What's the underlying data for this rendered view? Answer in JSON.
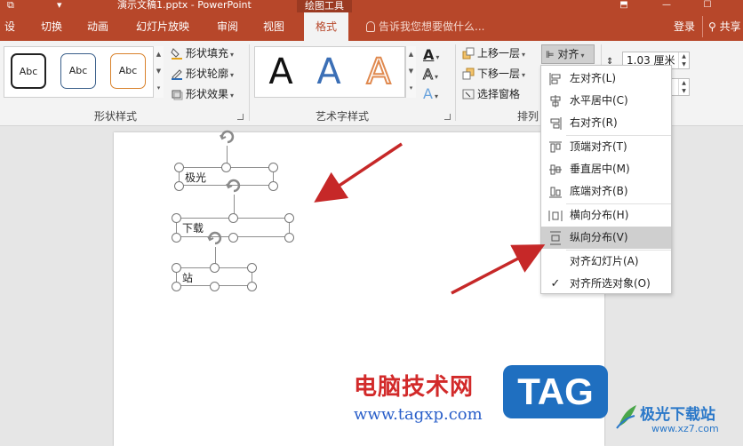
{
  "titlebar": {
    "filename": "演示文稿1.pptx - PowerPoint",
    "context_tab": "绘图工具"
  },
  "tabs": [
    "设计",
    "切换",
    "动画",
    "幻灯片放映",
    "审阅",
    "视图",
    "格式"
  ],
  "active_tab": "格式",
  "tellme": "告诉我您想要做什么...",
  "login": "登录",
  "share": "共享",
  "ribbon": {
    "shape_styles": {
      "swatches": [
        "Abc",
        "Abc",
        "Abc"
      ],
      "fill": "形状填充",
      "outline": "形状轮廓",
      "effect": "形状效果",
      "label": "形状样式"
    },
    "wordart": {
      "letters": [
        "A",
        "A",
        "A"
      ],
      "label": "艺术字样式"
    },
    "arrange": {
      "bring_forward": "上移一层",
      "send_backward": "下移一层",
      "selection_pane": "选择窗格",
      "align": "对齐",
      "label": "排列"
    },
    "size": {
      "height": "1.03 厘米",
      "width": ""
    }
  },
  "align_menu": [
    {
      "label": "左对齐(L)",
      "icon": "align-left-icon"
    },
    {
      "label": "水平居中(C)",
      "icon": "align-center-icon"
    },
    {
      "label": "右对齐(R)",
      "icon": "align-right-icon"
    },
    {
      "label": "顶端对齐(T)",
      "icon": "align-top-icon"
    },
    {
      "label": "垂直居中(M)",
      "icon": "align-middle-icon"
    },
    {
      "label": "底端对齐(B)",
      "icon": "align-bottom-icon"
    },
    {
      "label": "横向分布(H)",
      "icon": "distribute-horizontal-icon"
    },
    {
      "label": "纵向分布(V)",
      "icon": "distribute-vertical-icon"
    },
    {
      "label": "对齐幻灯片(A)",
      "icon": ""
    },
    {
      "label": "对齐所选对象(O)",
      "icon": "check-icon"
    }
  ],
  "highlighted_item": "纵向分布(V)",
  "slide": {
    "textboxes": [
      "极光",
      "下载",
      "站"
    ]
  },
  "watermark": {
    "line1": "电脑技术网",
    "line2": "www.tagxp.com",
    "tag": "TAG",
    "site_name": "极光下载站",
    "site_url": "www.xz7.com"
  },
  "colors": {
    "accent": "#b7472a",
    "arrow": "#c62828"
  }
}
